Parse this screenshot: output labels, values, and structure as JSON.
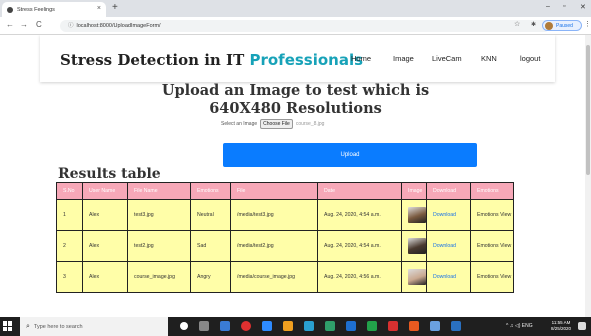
{
  "browser": {
    "tab_title": "Stress Feelings",
    "tab_close": "×",
    "new_tab": "+",
    "win_min": "–",
    "win_max": "▫",
    "win_close": "✕",
    "back": "←",
    "forward": "→",
    "reload": "C",
    "info_icon": "ⓘ",
    "url": "localhost:8000/UploadImageForm/",
    "star": "☆",
    "ext_icon": "✱",
    "profile_status": "Paused",
    "menu": "⋮"
  },
  "navbar": {
    "brand_main": "Stress Detection in IT ",
    "brand_accent": "Professionals",
    "links": [
      "Home",
      "Image",
      "LiveCam",
      "KNN",
      "logout"
    ]
  },
  "upload": {
    "heading_line1": "Upload an Image to test which is",
    "heading_line2": "640X480 Resolutions",
    "select_label": "Select an Image",
    "choose_button": "Choose File",
    "file_name": "course_8.jpg",
    "upload_button": "Upload"
  },
  "results": {
    "title": "Results table",
    "columns": [
      "S.No",
      "User Name",
      "File Name",
      "Emotions",
      "File",
      "Date",
      "Image",
      "Download",
      "Emotions"
    ],
    "rows": [
      {
        "sno": "1",
        "user": "Alex",
        "file_name": "test3.jpg",
        "emotion": "Neutral",
        "file": "/media/test3.jpg",
        "date": "Aug. 24, 2020, 4:54 a.m.",
        "download": "Download",
        "view": "Emotions View",
        "thumb_color": "#7a5a40"
      },
      {
        "sno": "2",
        "user": "Alex",
        "file_name": "test2.jpg",
        "emotion": "Sad",
        "file": "/media/test2.jpg",
        "date": "Aug. 24, 2020, 4:54 a.m.",
        "download": "Download",
        "view": "Emotions View",
        "thumb_color": "#4a3a30"
      },
      {
        "sno": "3",
        "user": "Alex",
        "file_name": "course_image.jpg",
        "emotion": "Angry",
        "file": "/media/course_image.jpg",
        "date": "Aug. 24, 2020, 4:56 a.m.",
        "download": "Download",
        "view": "Emotions View",
        "thumb_color": "#c9a890"
      }
    ]
  },
  "taskbar": {
    "search_icon": "⌕",
    "search_placeholder": "Type here to search",
    "time": "11:55 AM",
    "date": "8/25/2020",
    "tray": "^ ♫ ◁) ENG"
  }
}
